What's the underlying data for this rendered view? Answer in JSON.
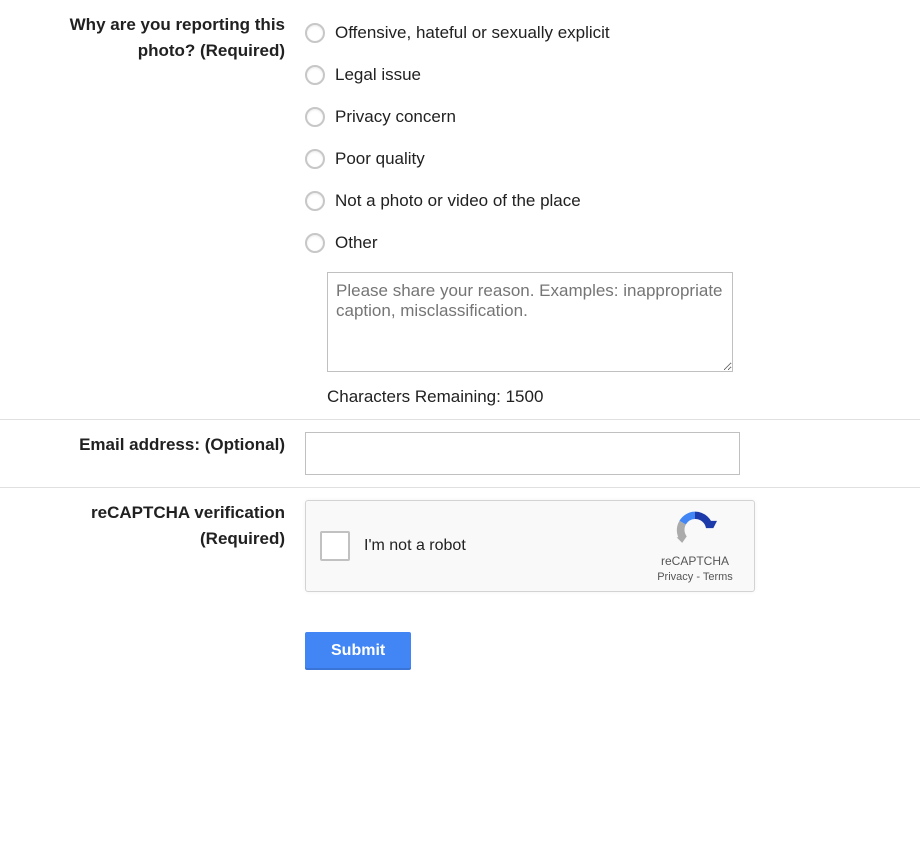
{
  "reason": {
    "label": "Why are you reporting this photo? (Required)",
    "options": [
      "Offensive, hateful or sexually explicit",
      "Legal issue",
      "Privacy concern",
      "Poor quality",
      "Not a photo or video of the place",
      "Other"
    ],
    "other_placeholder": "Please share your reason. Examples: inappropriate caption, misclassification.",
    "char_remaining": "Characters Remaining: 1500"
  },
  "email": {
    "label": "Email address: (Optional)",
    "value": ""
  },
  "recaptcha": {
    "label": "reCAPTCHA verification (Required)",
    "checkbox_label": "I'm not a robot",
    "brand": "reCAPTCHA",
    "privacy": "Privacy",
    "terms": "Terms"
  },
  "submit": {
    "label": "Submit"
  }
}
